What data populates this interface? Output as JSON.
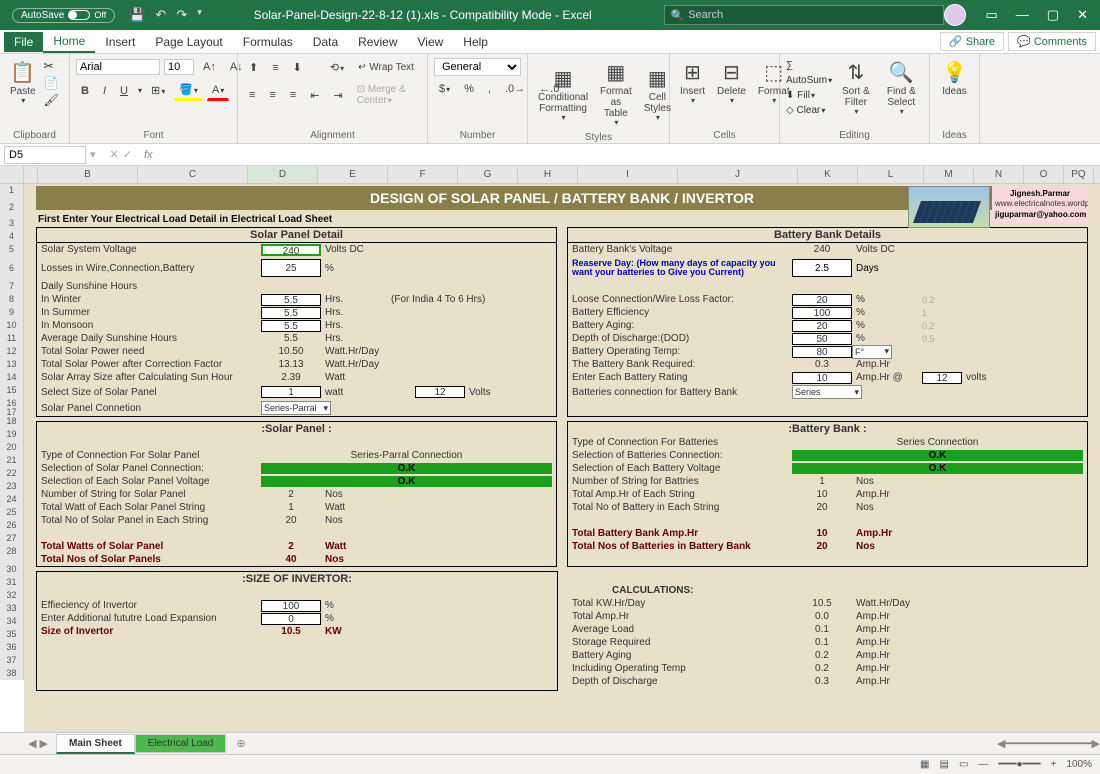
{
  "title": "Solar-Panel-Design-22-8-12 (1).xls - Compatibility Mode - Excel",
  "autosave": "AutoSave",
  "search_ph": "Search",
  "menu": {
    "file": "File",
    "home": "Home",
    "insert": "Insert",
    "pagelayout": "Page Layout",
    "formulas": "Formulas",
    "data": "Data",
    "review": "Review",
    "view": "View",
    "help": "Help",
    "share": "Share",
    "comments": "Comments"
  },
  "ribbon": {
    "clipboard": "Clipboard",
    "font": "Font",
    "alignment": "Alignment",
    "number": "Number",
    "styles": "Styles",
    "cells": "Cells",
    "editing": "Editing",
    "ideas": "Ideas",
    "paste": "Paste",
    "fontname": "Arial",
    "fontsize": "10",
    "wrap": "Wrap Text",
    "merge": "Merge & Center",
    "numfmt": "General",
    "cf": "Conditional\nFormatting",
    "fat": "Format as\nTable",
    "cs": "Cell\nStyles",
    "insert": "Insert",
    "delete": "Delete",
    "format": "Format",
    "autosum": "AutoSum",
    "fill": "Fill",
    "clear": "Clear",
    "sort": "Sort &\nFilter",
    "find": "Find &\nSelect",
    "ideas2": "Ideas"
  },
  "cellref": "D5",
  "banner": "DESIGN OF SOLAR PANEL / BATTERY BANK / INVERTOR",
  "instr": "First Enter Your Electrical Load Detail in Electrical Load Sheet",
  "author": {
    "n": "Jignesh.Parmar",
    "s": "www.electricalnotes.wordpress.com",
    "e": "jiguparmar@yahoo.com"
  },
  "sp": {
    "h": "Solar Panel Detail",
    "ssv": "Solar System Voltage",
    "ssv_v": "240",
    "ssv_u": "Volts DC",
    "loss": "Losses in Wire,Connection,Battery",
    "loss_v": "25",
    "loss_u": "%",
    "dsh": "Daily Sunshine Hours",
    "win": "In Winter",
    "win_v": "5.5",
    "sum": "In Summer",
    "sum_v": "5.5",
    "mon": "In Monsoon",
    "mon_v": "5.5",
    "avg": "Average Daily Sunshine Hours",
    "avg_v": "5.5",
    "hrs": "Hrs.",
    "note": "(For India 4 To 6 Hrs)",
    "tsp": "Total Solar Power need",
    "tsp_v": "10.50",
    "whr": "Watt.Hr/Day",
    "tspc": "Total Solar Power after Correction Factor",
    "tspc_v": "13.13",
    "sas": "Solar Array Size after Calculating Sun Hour",
    "sas_v": "2.39",
    "watt": "Watt",
    "sel": "Select Size of Solar Panel",
    "sel_w": "1",
    "sel_wl": "watt",
    "sel_v": "12",
    "sel_vl": "Volts",
    "spc": "Solar Panel Connetion",
    "spc_v": "Series-Parral"
  },
  "bb": {
    "h": "Battery Bank Details",
    "bv": "Battery Bank's Voltage",
    "bv_v": "240",
    "bv_u": "Volts DC",
    "rd": "Reaserve Day: (How many days of capacity you want your batteries to Give you Current)",
    "rd_v": "2.5",
    "rd_u": "Days",
    "lc": "Loose Connection/Wire Loss Factor:",
    "lc_v": "20",
    "pc": "%",
    "lc_f": "0.2",
    "be": "Battery Efficiency",
    "be_v": "100",
    "be_f": "1",
    "ba": "Battery Aging:",
    "ba_v": "20",
    "ba_f": "0.2",
    "dod": "Depth of Discharge:(DOD)",
    "dod_v": "50",
    "dod_f": "0.5",
    "bot": "Battery Operating Temp:",
    "bot_v": "80",
    "bot_u": "F°",
    "bbr": "The Battery Bank Required:",
    "bbr_v": "0.3",
    "ah": "Amp.Hr",
    "ebr": "Enter Each Battery Rating",
    "ebr_v": "10",
    "ebr_u": "Amp.Hr @",
    "ebr_vv": "12",
    "volts": "volts",
    "bcb": "Batteries connection for Battery Bank",
    "bcb_v": "Series"
  },
  "sp2": {
    "h": ":Solar Panel :",
    "tc": "Type of Connection For Solar Panel",
    "tc_v": "Series-Parral Connection",
    "ssc": "Selection of Solar Panel Connection:",
    "ok": "O.K",
    "sev": "Selection of Each Solar Panel Voltage",
    "nsp": "Number of String for Solar Panel",
    "nsp_v": "2",
    "nos": "Nos",
    "twe": "Total Watt of Each Solar Panel String",
    "twe_v": "1",
    "tne": "Total No of Solar Panel in Each String",
    "tne_v": "20",
    "tws": "Total Watts of Solar Panel",
    "tws_v": "2",
    "tns": "Total Nos of Solar Panels",
    "tns_v": "40"
  },
  "bb2": {
    "h": ":Battery Bank :",
    "tc": "Type of Connection For Batteries",
    "tc_v": "Series Connection",
    "sbc": "Selection of Batteries Connection:",
    "sbv": "Selection of Each Battery Voltage",
    "nsb": "Number of String for Battries",
    "nsb_v": "1",
    "tah": "Total Amp.Hr of Each String",
    "tah_v": "10",
    "tnb": "Total No of Battery in Each String",
    "tnb_v": "20",
    "tbah": "Total Battery Bank Amp.Hr",
    "tbah_v": "10",
    "tnbb": "Total Nos of Batteries in Battery Bank",
    "tnbb_v": "20"
  },
  "inv": {
    "h": ":SIZE OF INVERTOR:",
    "ei": "Effieciency of Invertor",
    "ei_v": "100",
    "eal": "Enter Additional fututre Load Expansion",
    "eal_v": "0",
    "si": "Size of Invertor",
    "si_v": "10.5",
    "kw": "KW"
  },
  "calc": {
    "h": "CALCULATIONS:",
    "tkw": "Total KW.Hr/Day",
    "tkw_v": "10.5",
    "tah": "Total Amp.Hr",
    "tah_v": "0.0",
    "al": "Average Load",
    "al_v": "0.1",
    "sr": "Storage Required",
    "sr_v": "0.1",
    "ba": "Battery Aging",
    "ba_v": "0.2",
    "iot": "Including Operating Temp",
    "iot_v": "0.2",
    "dod": "Depth of Discharge",
    "dod_v": "0.3"
  },
  "sheets": {
    "main": "Main Sheet",
    "el": "Electrical Load"
  },
  "zoom": "100%"
}
